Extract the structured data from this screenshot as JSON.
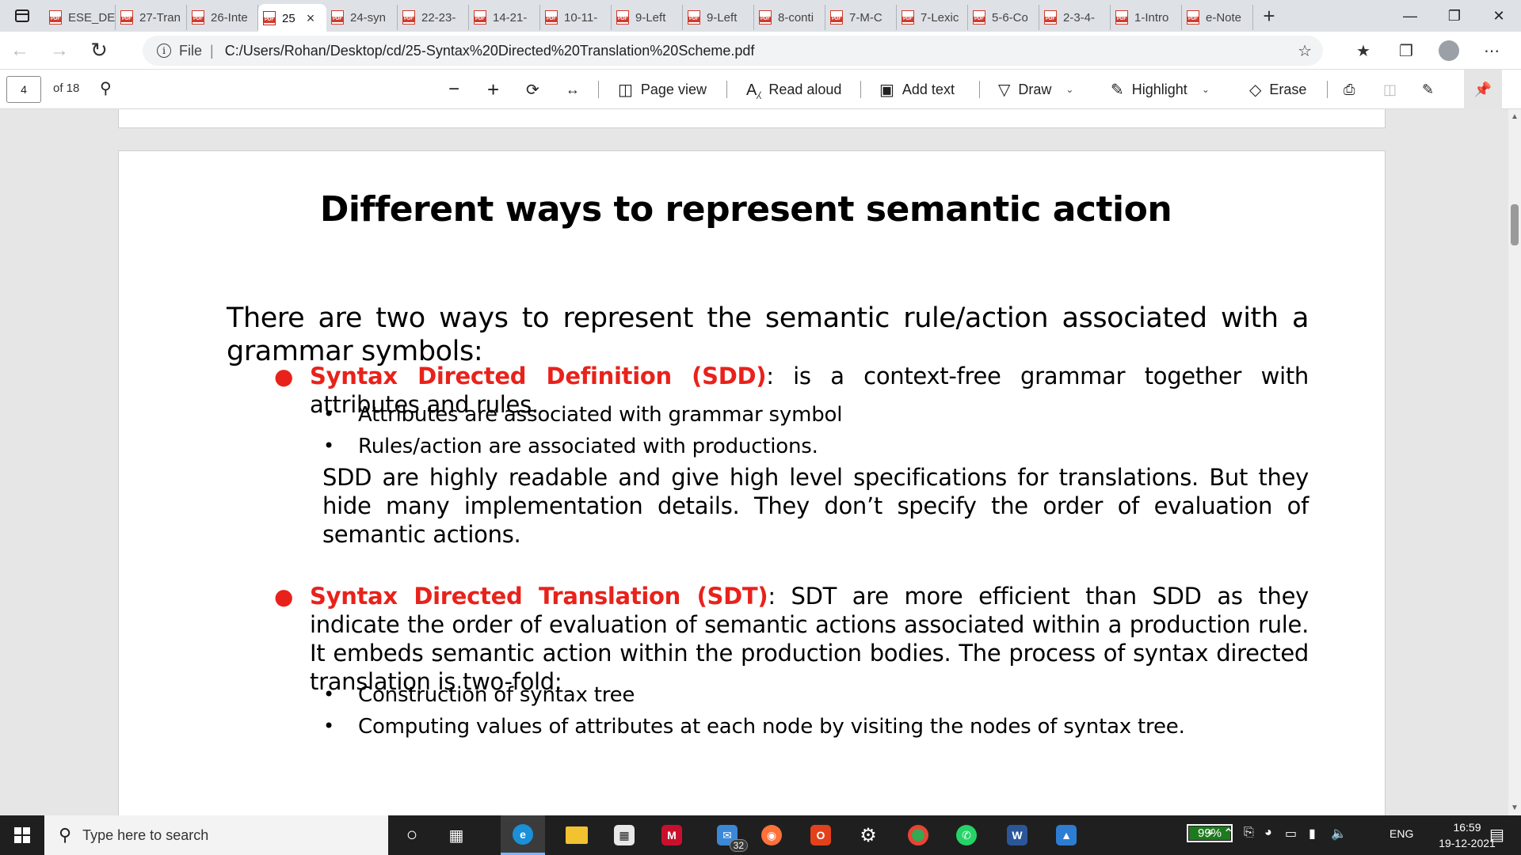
{
  "tabs": [
    {
      "label": "ESE_DE",
      "width": 94
    },
    {
      "label": "27-Tran",
      "width": 94
    },
    {
      "label": "26-Inte",
      "width": 94
    },
    {
      "label": "25",
      "width": 94,
      "active": true
    },
    {
      "label": "24-syn",
      "width": 94
    },
    {
      "label": "22-23-",
      "width": 94
    },
    {
      "label": "14-21-",
      "width": 94
    },
    {
      "label": "10-11-",
      "width": 94
    },
    {
      "label": "9-Left",
      "width": 94
    },
    {
      "label": "9-Left",
      "width": 94
    },
    {
      "label": "8-conti",
      "width": 94
    },
    {
      "label": "7-M-C",
      "width": 94
    },
    {
      "label": "7-Lexic",
      "width": 94
    },
    {
      "label": "5-6-Co",
      "width": 94
    },
    {
      "label": "2-3-4-",
      "width": 94
    },
    {
      "label": "1-Intro",
      "width": 94
    },
    {
      "label": "e-Note",
      "width": 94
    }
  ],
  "address": {
    "scheme_label": "File",
    "url": "C:/Users/Rohan/Desktop/cd/25-Syntax%20Directed%20Translation%20Scheme.pdf"
  },
  "pdf_toolbar": {
    "page_number": "4",
    "page_total": "of 18",
    "page_view": "Page view",
    "read_aloud": "Read aloud",
    "add_text": "Add text",
    "draw": "Draw",
    "highlight": "Highlight",
    "erase": "Erase"
  },
  "slide": {
    "title": "Different ways to represent semantic action",
    "intro": "There are two ways to represent the semantic rule/action associated with a grammar symbols:",
    "sdd": {
      "term": "Syntax Directed Definition (SDD)",
      "text": ": is a context-free grammar together with attributes and rules.",
      "subitems": [
        "Attributes are associated with grammar symbol",
        "Rules/action are associated with productions."
      ],
      "paragraph": "SDD are highly readable and give high level specifications for translations. But they hide many implementation details. They don’t specify the order of evaluation of semantic actions."
    },
    "sdt": {
      "term": "Syntax Directed Translation (SDT)",
      "text": ": SDT are more efficient than SDD as they indicate the order of evaluation of semantic actions associated within a production rule. It embeds semantic action within the production bodies. The process of syntax directed translation is two-fold:",
      "subitems": [
        "Construction of syntax tree",
        "Computing values of attributes at each node by visiting the nodes of syntax tree."
      ]
    }
  },
  "taskbar": {
    "search_placeholder": "Type here to search",
    "mail_badge": "32",
    "battery": "99%",
    "language": "ENG",
    "time": "16:59",
    "date": "19-12-2021"
  },
  "colors": {
    "accent_red": "#e8221b",
    "taskbar": "#1f1f1f",
    "tabstrip": "#dee1e6"
  }
}
